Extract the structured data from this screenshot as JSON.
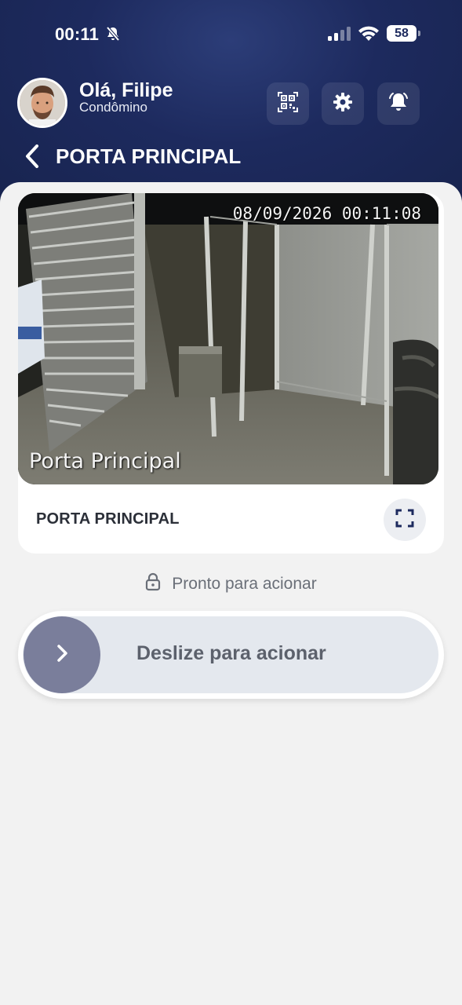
{
  "status_bar": {
    "time": "00:11",
    "battery": "58"
  },
  "user": {
    "greeting": "Olá, Filipe",
    "role": "Condômino"
  },
  "header": {
    "title": "PORTA PRINCIPAL"
  },
  "camera": {
    "timestamp": "08/09/2026 00:11:08",
    "overlay_label": "Porta Principal",
    "name": "PORTA PRINCIPAL"
  },
  "action": {
    "status_text": "Pronto para acionar",
    "slider_text": "Deslize para acionar"
  },
  "icons": {
    "status": [
      "bell-off-icon",
      "signal-icon",
      "wifi-icon",
      "battery-icon"
    ],
    "header_actions": [
      "qr-code-icon",
      "gear-icon",
      "bell-icon"
    ],
    "navigation": "chevron-left-icon",
    "card": "fullscreen-icon",
    "status_line": "lock-icon",
    "slider": "chevron-right-icon"
  },
  "colors": {
    "header_bg": "#1d2a5e",
    "page_bg": "#f2f2f2",
    "knob": "#7a7e9b",
    "track": "#e4e8ee"
  }
}
